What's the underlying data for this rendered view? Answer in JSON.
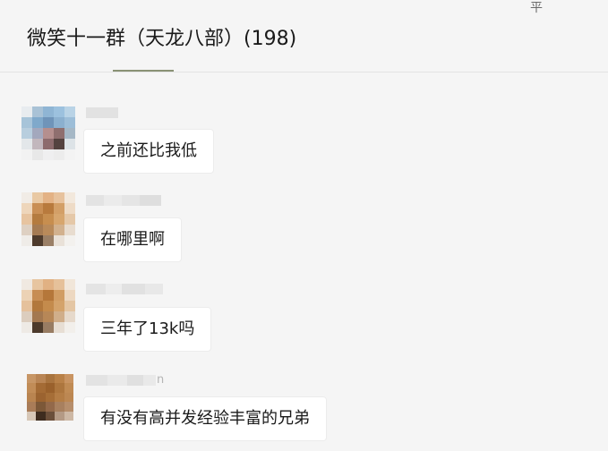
{
  "chat": {
    "title": "微笑十一群（天龙八部）(198)",
    "pin_glyph": "平"
  },
  "messages": [
    {
      "text": "之前还比我低",
      "sender_tail": ""
    },
    {
      "text": "在哪里啊",
      "sender_tail": ""
    },
    {
      "text": "三年了13k吗",
      "sender_tail": ""
    },
    {
      "text": "有没有高并发经验丰富的兄弟",
      "sender_tail": "n"
    }
  ]
}
